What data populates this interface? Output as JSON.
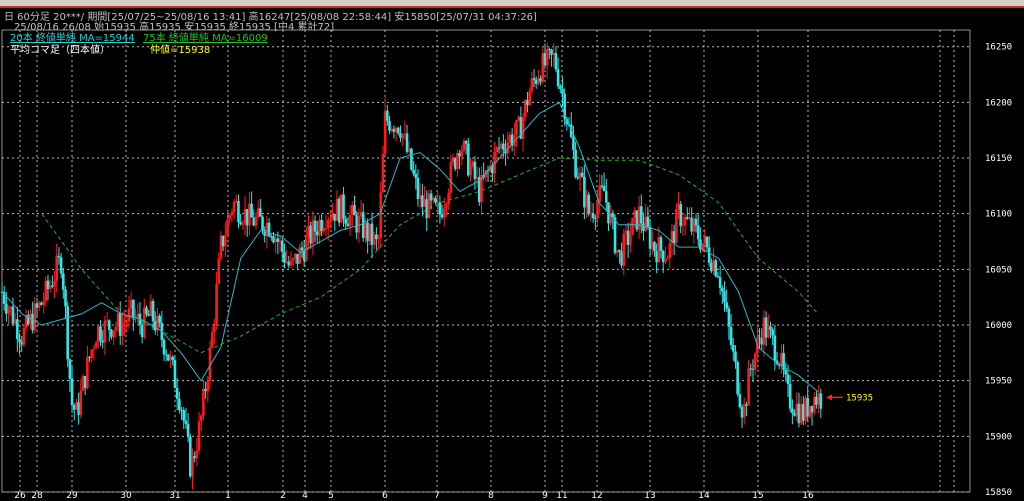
{
  "window": {
    "title_line1": "日 60分足 20***/ 期間[25/07/25~25/08/16 13:41] 高16247[25/08/08 22:58:44] 安15850[25/07/31 04:37:26]",
    "title_line2": "25/08/16 26/08 始15935 高15935 安15935 終15935 [中4 累計72]"
  },
  "legend": {
    "ma20": "20本 終値単純 MA=15944",
    "ma75": "75本 終値単純 MA=16009",
    "kind": "平均コマ足（四本値）",
    "mid": "仲値=15938"
  },
  "price_tag": "15935",
  "colors": {
    "up": "#ff1a1a",
    "down": "#33e6e6",
    "ma20": "#27b8c8",
    "ma75": "#22b022",
    "grid": "#b8b8b8",
    "axis_text": "#ffffff",
    "tag": "#ffff00"
  },
  "chart_data": {
    "type": "candlestick",
    "y_ticks": [
      15850,
      15900,
      15950,
      16000,
      16050,
      16100,
      16150,
      16200,
      16250
    ],
    "ylim": [
      15850,
      16265
    ],
    "x_labels": [
      "26",
      "28",
      "29",
      "30",
      "31",
      "1",
      "2",
      "4",
      "5",
      "6",
      "7",
      "8",
      "9",
      "11",
      "12",
      "13",
      "14",
      "15",
      "16"
    ],
    "price_level": 15935,
    "series_ma20": [
      [
        0,
        16030
      ],
      [
        20,
        16010
      ],
      [
        40,
        16000
      ],
      [
        60,
        16005
      ],
      [
        80,
        16010
      ],
      [
        100,
        16020
      ],
      [
        120,
        16010
      ],
      [
        140,
        16005
      ],
      [
        160,
        15995
      ],
      [
        180,
        15975
      ],
      [
        200,
        15950
      ],
      [
        220,
        15980
      ],
      [
        240,
        16060
      ],
      [
        260,
        16085
      ],
      [
        280,
        16080
      ],
      [
        300,
        16065
      ],
      [
        320,
        16075
      ],
      [
        340,
        16085
      ],
      [
        360,
        16090
      ],
      [
        380,
        16100
      ],
      [
        400,
        16150
      ],
      [
        420,
        16155
      ],
      [
        440,
        16140
      ],
      [
        460,
        16120
      ],
      [
        480,
        16130
      ],
      [
        500,
        16150
      ],
      [
        520,
        16170
      ],
      [
        540,
        16190
      ],
      [
        560,
        16200
      ],
      [
        580,
        16160
      ],
      [
        600,
        16110
      ],
      [
        620,
        16090
      ],
      [
        640,
        16090
      ],
      [
        660,
        16085
      ],
      [
        680,
        16070
      ],
      [
        700,
        16070
      ],
      [
        720,
        16060
      ],
      [
        740,
        16030
      ],
      [
        760,
        15980
      ],
      [
        780,
        15965
      ],
      [
        800,
        15955
      ],
      [
        820,
        15940
      ]
    ],
    "series_ma75": [
      [
        40,
        16100
      ],
      [
        80,
        16050
      ],
      [
        120,
        16010
      ],
      [
        160,
        15995
      ],
      [
        200,
        15975
      ],
      [
        240,
        15990
      ],
      [
        280,
        16010
      ],
      [
        320,
        16025
      ],
      [
        360,
        16050
      ],
      [
        400,
        16090
      ],
      [
        440,
        16110
      ],
      [
        480,
        16120
      ],
      [
        520,
        16135
      ],
      [
        560,
        16150
      ],
      [
        600,
        16148
      ],
      [
        640,
        16148
      ],
      [
        680,
        16135
      ],
      [
        720,
        16110
      ],
      [
        760,
        16060
      ],
      [
        800,
        16030
      ],
      [
        820,
        16010
      ]
    ],
    "price_path": [
      [
        0,
        16030
      ],
      [
        20,
        15990
      ],
      [
        40,
        16020
      ],
      [
        50,
        16040
      ],
      [
        60,
        16060
      ],
      [
        70,
        15930
      ],
      [
        75,
        15920
      ],
      [
        85,
        15960
      ],
      [
        95,
        15995
      ],
      [
        110,
        16000
      ],
      [
        120,
        16000
      ],
      [
        130,
        16010
      ],
      [
        140,
        16000
      ],
      [
        150,
        16010
      ],
      [
        165,
        15980
      ],
      [
        180,
        15930
      ],
      [
        190,
        15870
      ],
      [
        200,
        15915
      ],
      [
        210,
        15980
      ],
      [
        220,
        16070
      ],
      [
        232,
        16110
      ],
      [
        250,
        16095
      ],
      [
        270,
        16090
      ],
      [
        290,
        16050
      ],
      [
        310,
        16080
      ],
      [
        325,
        16100
      ],
      [
        340,
        16105
      ],
      [
        360,
        16090
      ],
      [
        378,
        16070
      ],
      [
        385,
        16185
      ],
      [
        400,
        16180
      ],
      [
        420,
        16110
      ],
      [
        440,
        16100
      ],
      [
        460,
        16165
      ],
      [
        480,
        16120
      ],
      [
        500,
        16160
      ],
      [
        520,
        16175
      ],
      [
        530,
        16210
      ],
      [
        540,
        16230
      ],
      [
        555,
        16240
      ],
      [
        565,
        16200
      ],
      [
        575,
        16150
      ],
      [
        590,
        16100
      ],
      [
        605,
        16120
      ],
      [
        620,
        16060
      ],
      [
        640,
        16100
      ],
      [
        655,
        16070
      ],
      [
        670,
        16065
      ],
      [
        680,
        16100
      ],
      [
        700,
        16080
      ],
      [
        720,
        16050
      ],
      [
        735,
        15970
      ],
      [
        745,
        15920
      ],
      [
        752,
        15960
      ],
      [
        765,
        16000
      ],
      [
        780,
        15975
      ],
      [
        790,
        15935
      ],
      [
        805,
        15920
      ],
      [
        815,
        15935
      ],
      [
        825,
        15935
      ]
    ]
  }
}
